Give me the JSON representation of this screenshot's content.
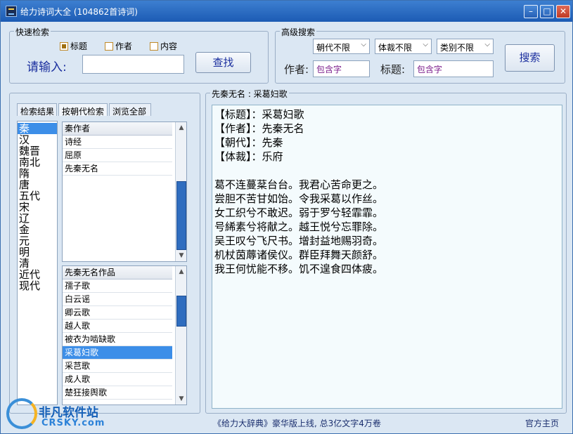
{
  "window": {
    "title": "给力诗词大全 (104862首诗词)",
    "minimize": "–",
    "maximize": "□",
    "close": "✕"
  },
  "quick_search": {
    "legend": "快速检索",
    "options": [
      {
        "label": "标题",
        "checked": true
      },
      {
        "label": "作者",
        "checked": false
      },
      {
        "label": "内容",
        "checked": false
      }
    ],
    "input_label": "请输入:",
    "input_value": "",
    "search_button": "查找"
  },
  "advanced_search": {
    "legend": "高级搜索",
    "dynasty_select": "朝代不限",
    "genre_select": "体裁不限",
    "category_select": "类别不限",
    "author_label": "作者:",
    "author_placeholder": "包含字",
    "title_label": "标题:",
    "title_placeholder": "包含字",
    "search_button": "搜索"
  },
  "left_panel": {
    "tabs": [
      "检索结果",
      "按朝代检索",
      "浏览全部"
    ],
    "active_tab": 1,
    "dynasties": [
      "秦",
      "汉",
      "魏晋",
      "南北",
      "隋",
      "唐",
      "五代",
      "宋",
      "辽",
      "金",
      "元",
      "明",
      "清",
      "近代",
      "现代"
    ],
    "selected_dynasty": 0,
    "authors_header": "秦作者",
    "authors": [
      "诗经",
      "屈原",
      "先秦无名"
    ],
    "works_header": "先秦无名作品",
    "works": [
      "孺子歌",
      "白云谣",
      "卿云歌",
      "越人歌",
      "被衣为啮缺歌",
      "采葛妇歌",
      "采芑歌",
      "成人歌",
      "楚狂接舆歌"
    ],
    "selected_work": 5
  },
  "poem": {
    "panel_title": "先秦无名 : 采葛妇歌",
    "meta": [
      "【标题】：采葛妇歌",
      "【作者】：先秦无名",
      "【朝代】：先秦",
      "【体裁】：乐府"
    ],
    "lines": [
      "葛不连蔓棻台台。我君心苦命更之。",
      "尝胆不苦甘如饴。令我采葛以作丝。",
      "女工织兮不敢迟。弱于罗兮轻霏霏。",
      "号絺素兮将献之。越王悦兮忘罪除。",
      "吴王叹兮飞尺书。增封益地赐羽奇。",
      "机杖茵蓐诸侯仪。群臣拜舞天颜舒。",
      "我王何忧能不移。饥不遑食四体疲。"
    ]
  },
  "status": {
    "ad_text": "《给力大辞典》豪华版上线, 总3亿文字4万卷",
    "homepage_link": "官方主页"
  },
  "watermark": {
    "cn": "非凡软件站",
    "en": "CRSKY.com"
  },
  "colors": {
    "titlebar": "#1c5bb4",
    "window_bg": "#dbe7f3",
    "selection": "#3c8ee8",
    "label_blue": "#1a2e9e",
    "poem_bg": "#f4fbfd"
  }
}
